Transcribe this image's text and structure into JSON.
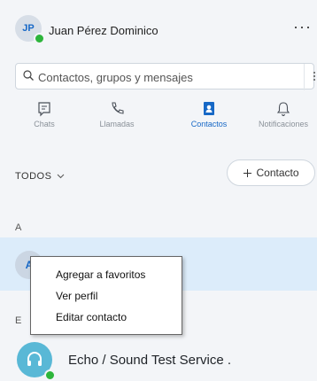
{
  "header": {
    "avatar_initials": "JP",
    "username": "Juan Pérez Dominico",
    "more_label": "···"
  },
  "search": {
    "placeholder": "Contactos, grupos y mensajes"
  },
  "tabs": [
    {
      "label": "Chats",
      "icon": "chat-icon",
      "active": false
    },
    {
      "label": "Llamadas",
      "icon": "phone-icon",
      "active": false
    },
    {
      "label": "Contactos",
      "icon": "contacts-icon",
      "active": true
    },
    {
      "label": "Notificaciones",
      "icon": "bell-icon",
      "active": false
    }
  ],
  "filter": {
    "label": "TODOS"
  },
  "add_contact": {
    "label": "Contacto",
    "icon": "plus-icon"
  },
  "sections": [
    {
      "letter": "A"
    },
    {
      "letter": "E"
    }
  ],
  "context_menu": {
    "items": [
      "Agregar a favoritos",
      "Ver perfil",
      "Editar contacto"
    ]
  },
  "contacts": {
    "selected_initial": "A",
    "echo_name": "Echo / Sound Test Service ."
  },
  "colors": {
    "accent": "#1768c6",
    "presence": "#2db53b",
    "selected_row": "#dcecfa"
  }
}
